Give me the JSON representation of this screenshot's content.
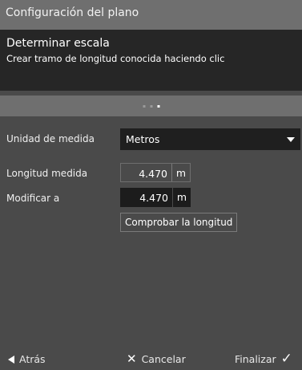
{
  "titlebar": {
    "title": "Configuración del plano"
  },
  "header": {
    "title": "Determinar escala",
    "subtitle": "Crear tramo de longitud conocida haciendo clic"
  },
  "progress": {
    "steps": 3,
    "current": 3
  },
  "form": {
    "unit": {
      "label": "Unidad de medida",
      "value": "Metros"
    },
    "measured": {
      "label": "Longitud medida",
      "value": "4.470",
      "unit": "m"
    },
    "modify": {
      "label": "Modificar a",
      "value": "4.470",
      "unit": "m"
    },
    "check_button": "Comprobar la longitud"
  },
  "footer": {
    "back": "Atrás",
    "cancel": "Cancelar",
    "finish": "Finalizar"
  },
  "icons": {
    "back": "triangle-left-icon",
    "cancel": "x-icon",
    "finish": "check-icon",
    "dropdown": "caret-down-icon"
  },
  "colors": {
    "background": "#4a4a4a",
    "titlebar": "#6f6f6f",
    "header": "#262626",
    "field_dark": "#1f1f1f"
  }
}
